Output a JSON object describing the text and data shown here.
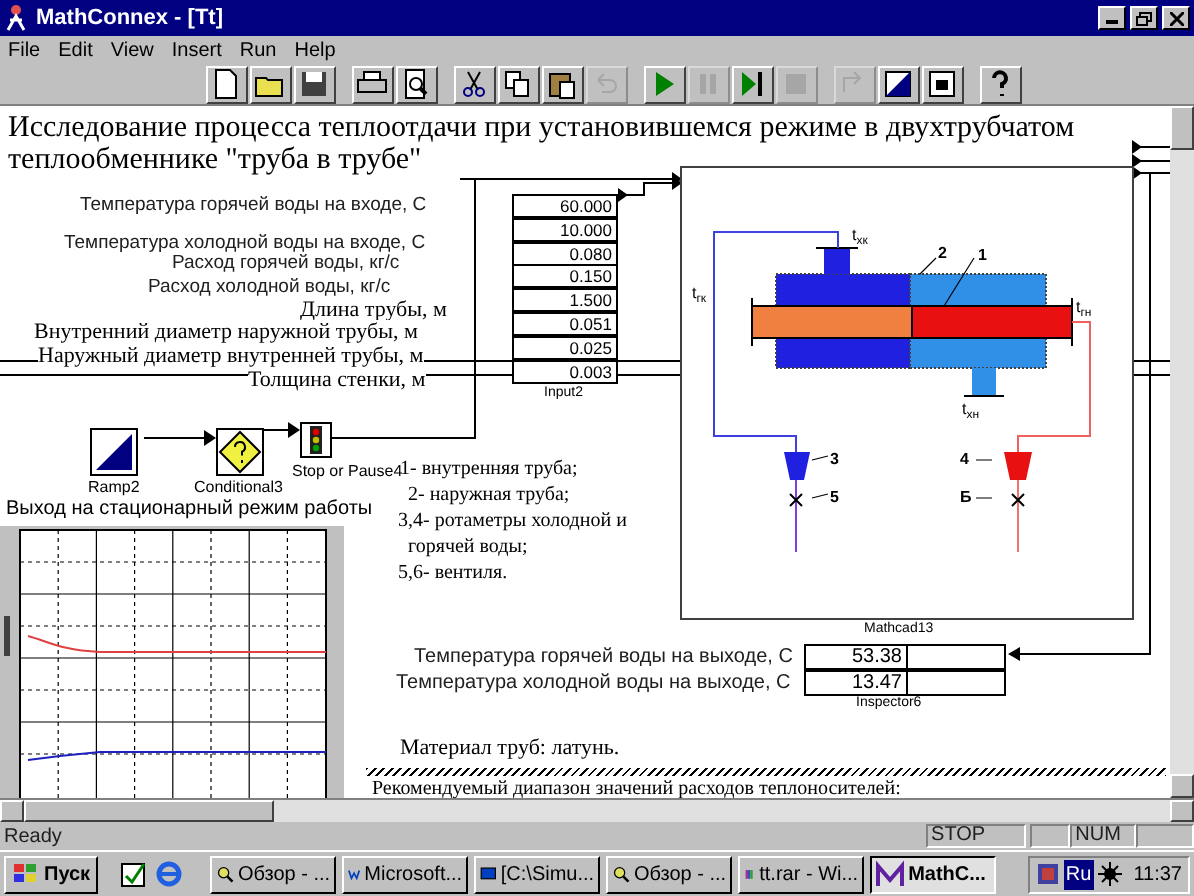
{
  "window": {
    "title": "MathConnex - [Tt]"
  },
  "menu": [
    "File",
    "Edit",
    "View",
    "Insert",
    "Run",
    "Help"
  ],
  "toolbar": [
    [
      {
        "kind": "new",
        "disabled": false
      },
      {
        "kind": "open",
        "disabled": false
      },
      {
        "kind": "save",
        "disabled": false
      }
    ],
    [
      {
        "kind": "print",
        "disabled": false
      },
      {
        "kind": "preview",
        "disabled": false
      }
    ],
    [
      {
        "kind": "cut",
        "disabled": false
      },
      {
        "kind": "copy",
        "disabled": false
      },
      {
        "kind": "paste",
        "disabled": false
      },
      {
        "kind": "undo",
        "disabled": true
      }
    ],
    [
      {
        "kind": "run",
        "disabled": false
      },
      {
        "kind": "pause",
        "disabled": true
      },
      {
        "kind": "step",
        "disabled": false
      },
      {
        "kind": "stop",
        "disabled": true
      }
    ],
    [
      {
        "kind": "wire",
        "disabled": true
      },
      {
        "kind": "contrast",
        "disabled": false
      },
      {
        "kind": "fill",
        "disabled": false
      }
    ],
    [
      {
        "kind": "help",
        "disabled": false
      }
    ]
  ],
  "document": {
    "heading": "Исследование процесса теплоотдачи при установившемся режиме в двухтрубчатом теплообменнике \"труба в трубе\"",
    "parameters": [
      {
        "label": "Температура горячей воды на входе, С",
        "value": "60.000",
        "kind": "sans"
      },
      {
        "label": "Температура холодной воды на входе, С",
        "value": "10.000",
        "kind": "sans"
      },
      {
        "label": "Расход горячей воды, кг/с",
        "value": "0.080",
        "kind": "sans"
      },
      {
        "label": "Расход холодной воды, кг/с",
        "value": "0.150",
        "kind": "sans"
      },
      {
        "label": "Длина трубы, м",
        "value": "1.500",
        "kind": "serif"
      },
      {
        "label": "Внутренний диаметр наружной трубы, м",
        "value": "0.051",
        "kind": "serif"
      },
      {
        "label": "Наружный диаметр внутренней трубы, м",
        "value": "0.025",
        "kind": "serif"
      },
      {
        "label": "Толщина стенки, м",
        "value": "0.003",
        "kind": "serif"
      }
    ],
    "input_block": "Input2",
    "blocks": [
      {
        "kind": "ramp",
        "label": "Ramp2"
      },
      {
        "kind": "conditional",
        "label": "Conditional3"
      },
      {
        "kind": "stop",
        "label": "Stop or Pause4"
      }
    ],
    "chart_caption": "Выход на стационарный  режим работы",
    "legend": [
      "1- внутренняя труба;",
      "2- наружная труба;",
      "3,4- ротаметры холодной и",
      "горячей воды;",
      "5,6- вентиля."
    ],
    "diagram_labels": [
      {
        "kind": "tag",
        "text": "t$_{хк}$"
      },
      {
        "kind": "tag",
        "text": "t$_{гк}$"
      },
      {
        "kind": "tag",
        "text": "t$_{гн}$"
      },
      {
        "kind": "tag",
        "text": "t$_{хн}$"
      },
      {
        "kind": "num",
        "text": "2"
      },
      {
        "kind": "num",
        "text": "1"
      },
      {
        "kind": "num",
        "text": "3"
      },
      {
        "kind": "num",
        "text": "5"
      },
      {
        "kind": "num",
        "text": "4"
      },
      {
        "kind": "num",
        "text": "Б"
      }
    ],
    "mathcad_block": "Mathcad13",
    "outputs": [
      {
        "label": "Температура горячей воды на выходе, С",
        "value": "53.38"
      },
      {
        "label": "Температура холодной воды на выходе, С",
        "value": "13.47"
      }
    ],
    "inspector_block": "Inspector6",
    "material": "Материал труб: латунь.",
    "recommended": "Рекомендуемый диапазон значений расходов теплоносителей:"
  },
  "status_bar": [
    "Ready",
    "STOP",
    "NUM"
  ],
  "taskbar": {
    "start": "Пуск",
    "tasks": [
      {
        "label": "Обзор - ...",
        "selected": false
      },
      {
        "label": "Microsoft...",
        "selected": false
      },
      {
        "label": "[C:\\Simu...",
        "selected": false
      },
      {
        "label": "Обзор - ...",
        "selected": false
      },
      {
        "label": "tt.rar - Wi...",
        "selected": false
      },
      {
        "label": "MathC...",
        "selected": true
      }
    ],
    "language": "Ru",
    "clock": "11:37"
  }
}
